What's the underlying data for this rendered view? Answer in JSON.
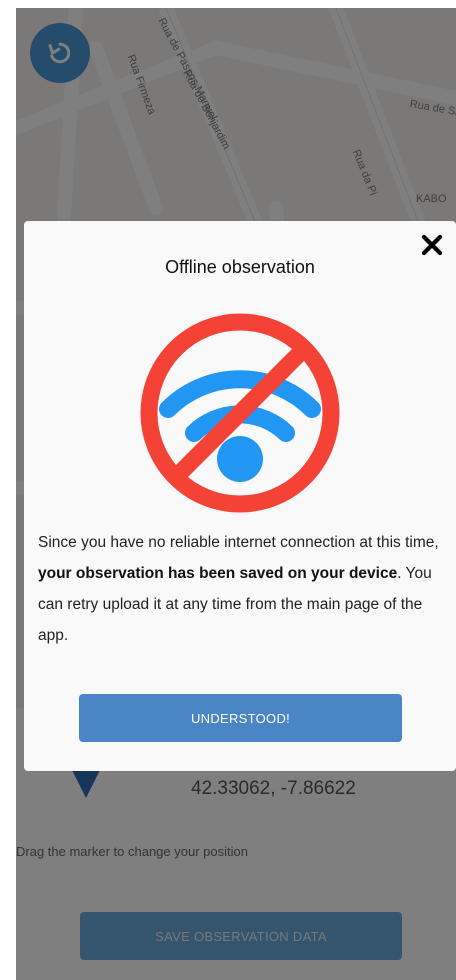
{
  "map": {
    "streets": [
      "Rua de Passos Manuel",
      "Rua Firmeza",
      "Rua do Bonjardim",
      "Rua de Sá",
      "Rua da Pi",
      "KABO"
    ]
  },
  "location": {
    "coordinates": "42.33062, -7.86622",
    "drag_hint": "Drag the marker to change your position",
    "save_label": "SAVE OBSERVATION DATA"
  },
  "modal": {
    "title": "Offline observation",
    "body_plain_1": "Since you have no reliable internet connection at this time, ",
    "body_bold": "your observation has been saved on your device",
    "body_plain_2": ". You can retry upload it at any time from the main page of the app.",
    "button_label": "UNDERSTOOD!",
    "icon": "wifi-off-icon",
    "close_icon": "close-icon"
  },
  "colors": {
    "wifi_blue": "#2196f3",
    "prohibition_red": "#f44336",
    "button_blue": "#4a86c5",
    "scrim": "rgba(0,0,0,0.5)"
  }
}
